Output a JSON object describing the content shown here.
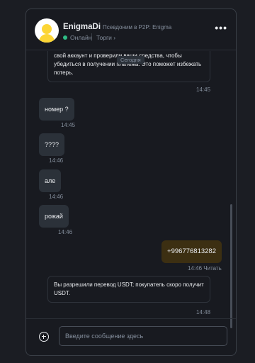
{
  "header": {
    "username": "EnigmaDi",
    "alias": "Псевдоним в P2P: Enigma",
    "status": "Онлайн",
    "trades_label": "Торги",
    "trades_chevron": "›",
    "menu": "•••"
  },
  "chat": {
    "today_label": "Сегодня",
    "top_card_text": "свой аккаунт и проверили ваши средства, чтобы убедиться в получении платежа. Это поможет избежать потерь.",
    "top_card_time": "14:45",
    "messages": [
      {
        "text": "номер ?",
        "time": "14:45"
      },
      {
        "text": "????",
        "time": "14:46"
      },
      {
        "text": "але",
        "time": "14:46"
      },
      {
        "text": "рожай",
        "time": "14:46"
      }
    ],
    "outgoing": {
      "text": "+996776813282",
      "time": "14:46",
      "read": "Читать"
    },
    "system_card": {
      "text": "Вы разрешили перевод USDT; покупатель скоро получит USDT.",
      "time": "14:48"
    }
  },
  "footer": {
    "input_placeholder": "Введите сообщение здесь"
  },
  "colors": {
    "background": "#181a20",
    "bubble_in": "#2b3139",
    "bubble_out": "#3c2f12",
    "online": "#2ebd85",
    "avatar": "#fcd535"
  }
}
